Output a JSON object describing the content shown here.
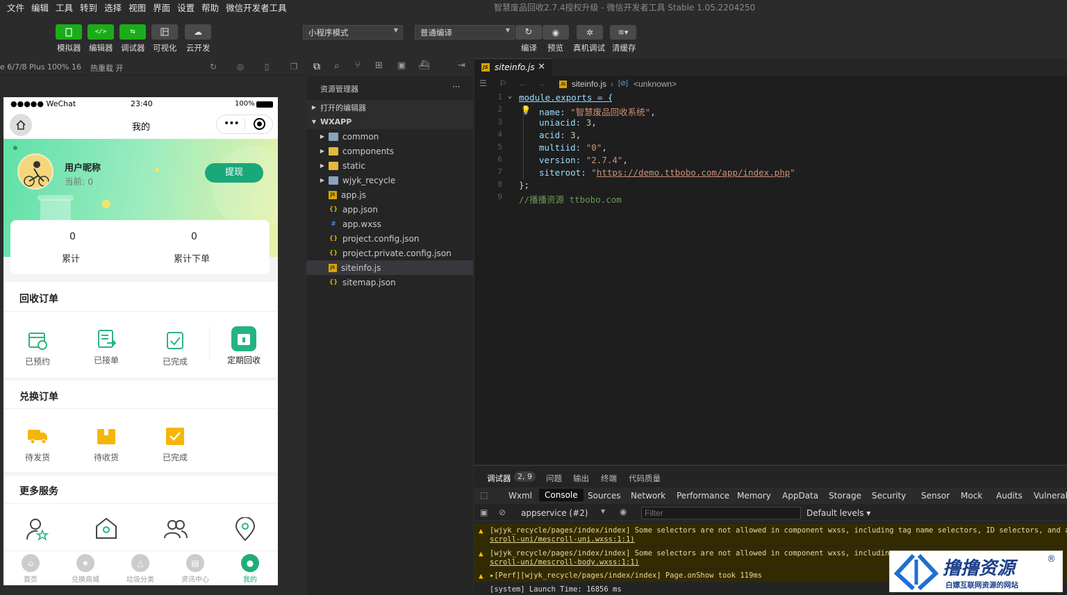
{
  "menu": [
    "文件",
    "编辑",
    "工具",
    "转到",
    "选择",
    "视图",
    "界面",
    "设置",
    "帮助",
    "微信开发者工具"
  ],
  "window_title": "智慧废品回收2.7.4授权升级 - 微信开发者工具 Stable 1.05.2204250",
  "toolbar": {
    "left_labels": [
      "模拟器",
      "编辑器",
      "调试器",
      "可视化",
      "云开发"
    ],
    "mode_select": "小程序模式",
    "compile_select": "普通编译",
    "right_labels": [
      "编译",
      "预览",
      "真机调试",
      "清缓存"
    ]
  },
  "simbar": {
    "device": "e 6/7/8 Plus 100% 16",
    "hotreload": "热重载 开"
  },
  "phone": {
    "status_carrier": "●●●●● WeChat",
    "status_time": "23:40",
    "status_battery": "100%",
    "nav_title": "我的",
    "user_name": "用户昵称",
    "user_current": "当前: 0",
    "withdraw_btn": "提现",
    "stats": [
      {
        "value": "0",
        "label": "累计"
      },
      {
        "value": "0",
        "label": "累计下单"
      }
    ],
    "section_recycle": "回收订单",
    "recycle_items": [
      "已预约",
      "已接单",
      "已完成",
      "定期回收"
    ],
    "section_exchange": "兑换订单",
    "exchange_items": [
      "待发货",
      "待收货",
      "已完成"
    ],
    "section_more": "更多服务",
    "tabs": [
      "首页",
      "兑换商城",
      "垃圾分类",
      "资讯中心",
      "我的"
    ]
  },
  "explorer": {
    "title": "资源管理器",
    "open_editors": "打开的编辑器",
    "root": "WXAPP",
    "items": [
      {
        "name": "common",
        "type": "folder"
      },
      {
        "name": "components",
        "type": "folder"
      },
      {
        "name": "static",
        "type": "folder"
      },
      {
        "name": "wjyk_recycle",
        "type": "folder"
      },
      {
        "name": "app.js",
        "type": "js"
      },
      {
        "name": "app.json",
        "type": "json"
      },
      {
        "name": "app.wxss",
        "type": "css"
      },
      {
        "name": "project.config.json",
        "type": "json"
      },
      {
        "name": "project.private.config.json",
        "type": "json"
      },
      {
        "name": "siteinfo.js",
        "type": "js"
      },
      {
        "name": "sitemap.json",
        "type": "json"
      }
    ]
  },
  "editor": {
    "tab": "siteinfo.js",
    "breadcrumb_file": "siteinfo.js",
    "breadcrumb_symbol": "<unknown>",
    "code": {
      "l1": "module.exports = {",
      "name_key": "name: ",
      "name_val": "\"智慧废品回收系统\"",
      "uniacid_key": "uniacid: ",
      "uniacid_val": "3",
      "acid_key": "acid: ",
      "acid_val": "3",
      "multiid_key": "multiid: ",
      "multiid_val": "\"0\"",
      "version_key": "version: ",
      "version_val": "\"2.7.4\"",
      "siteroot_key": "siteroot: ",
      "siteroot_url": "https://demo.ttbobo.com/app/index.php",
      "close": "};",
      "comment": "//播播资源 ttbobo.com"
    }
  },
  "devtools": {
    "top_tabs": [
      "调试器",
      "2, 9",
      "问题",
      "输出",
      "终端",
      "代码质量"
    ],
    "tabs": [
      "Wxml",
      "Console",
      "Sources",
      "Network",
      "Performance",
      "Memory",
      "AppData",
      "Storage",
      "Security",
      "Sensor",
      "Mock",
      "Audits",
      "Vulnerabi"
    ],
    "context": "appservice (#2)",
    "filter_placeholder": "Filter",
    "levels": "Default levels ▾",
    "logs": [
      {
        "l1": "[wjyk_recycle/pages/index/index] Some selectors are not allowed in component wxss, including tag name selectors, ID selectors, and a",
        "l2": "scroll-uni/mescroll-uni.wxss:1:1)"
      },
      {
        "l1": "[wjyk_recycle/pages/index/index] Some selectors are not allowed in component wxss, includin",
        "l2": "scroll-uni/mescroll-body.wxss:1:1)"
      },
      {
        "l1": "▸[Perf][wjyk_recycle/pages/index/index] Page.onShow took 119ms",
        "l2": ""
      },
      {
        "l1": "[system] Launch Time: 16856 ms",
        "l2": ""
      }
    ]
  },
  "watermark": {
    "title": "撸撸资源",
    "subtitle": "白嫖互联网资源的网站"
  }
}
